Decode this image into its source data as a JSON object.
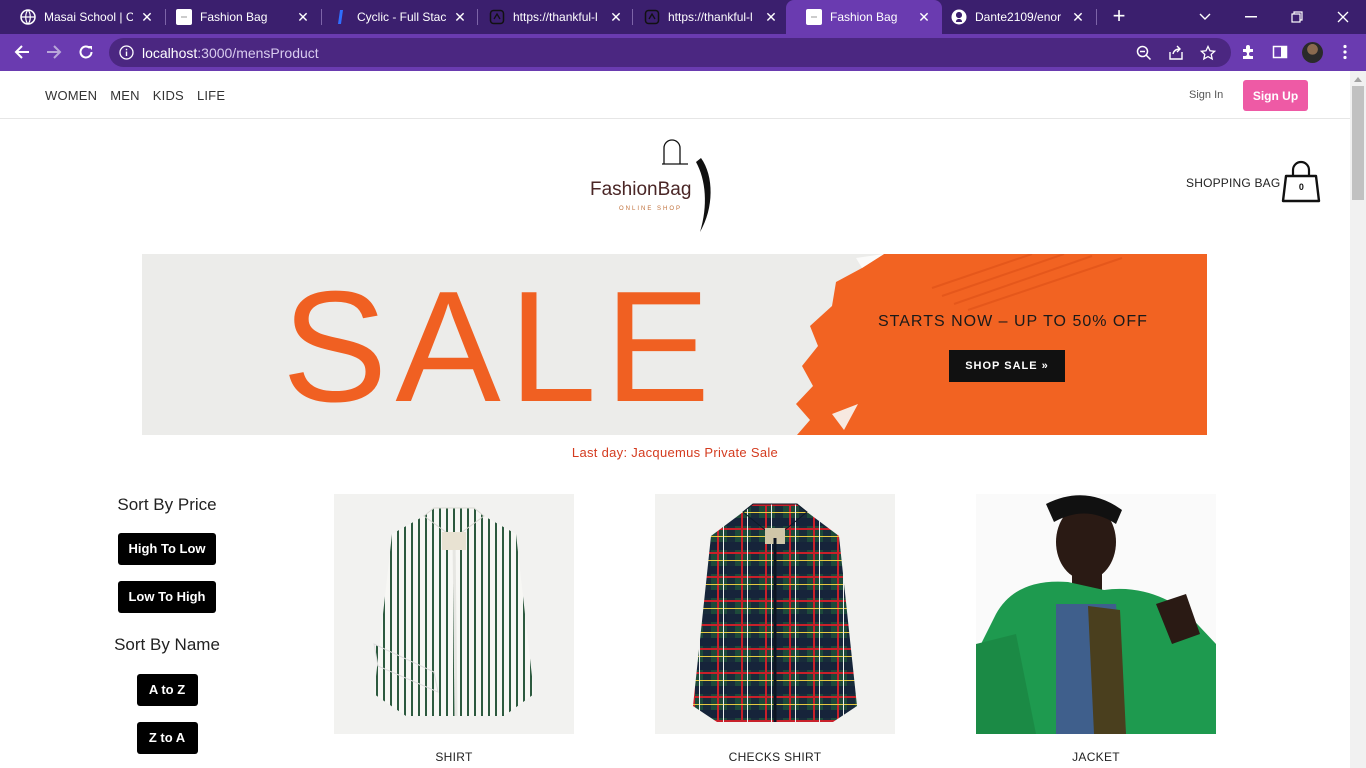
{
  "browser": {
    "tabs": [
      {
        "title": "Masai School | Co",
        "icon": "globe-icon",
        "active": false
      },
      {
        "title": "Fashion Bag",
        "icon": "page-icon",
        "active": false
      },
      {
        "title": "Cyclic - Full Stack",
        "icon": "cyclic-icon",
        "active": false
      },
      {
        "title": "https://thankful-l",
        "icon": "loading-icon",
        "active": false
      },
      {
        "title": "https://thankful-l",
        "icon": "loading-icon",
        "active": false
      },
      {
        "title": "Fashion Bag",
        "icon": "page-icon",
        "active": true
      },
      {
        "title": "Dante2109/enor",
        "icon": "github-icon",
        "active": false
      }
    ],
    "url_host": "localhost",
    "url_path": ":3000/mensProduct",
    "colors": {
      "tabstrip": "#3b1f6e",
      "toolbar": "#6a3bb0",
      "omnibox": "#4b2781"
    }
  },
  "site": {
    "nav": [
      "WOMEN",
      "MEN",
      "KIDS",
      "LIFE"
    ],
    "sign_in": "Sign In",
    "sign_up": "Sign Up",
    "logo_text": "FashionBag",
    "logo_sub": "ONLINE SHOP",
    "shopping_bag_label": "SHOPPING BAG",
    "bag_count": "0",
    "banner": {
      "sale_word": "SALE",
      "tagline": "STARTS NOW – UP TO 50% OFF",
      "cta": "SHOP SALE »"
    },
    "promo_text": "Last day: Jacquemus Private Sale",
    "sort": {
      "price_title": "Sort By Price",
      "high_to_low": "High To Low",
      "low_to_high": "Low To High",
      "name_title": "Sort By Name",
      "a_to_z": "A to Z",
      "z_to_a": "Z to A"
    },
    "products": [
      {
        "name": "SHIRT"
      },
      {
        "name": "CHECKS SHIRT"
      },
      {
        "name": "JACKET"
      }
    ],
    "colors": {
      "accent": "#ee5aa5",
      "sale_orange": "#f06022",
      "promo_red": "#d43b1f"
    }
  }
}
